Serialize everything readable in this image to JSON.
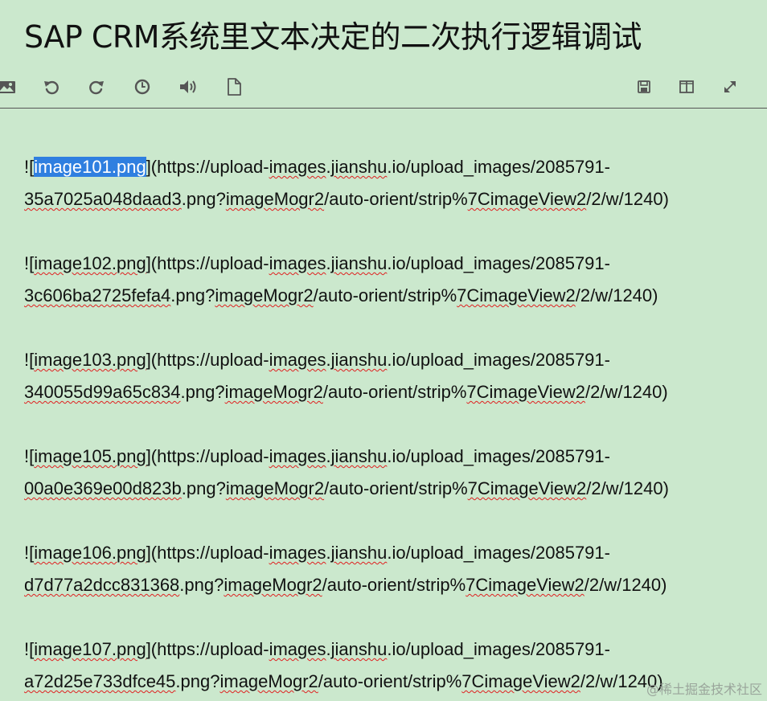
{
  "title": "SAP CRM系统里文本决定的二次执行逻辑调试",
  "toolbar": {
    "left": [
      "image-icon",
      "undo-icon",
      "redo-icon",
      "history-icon",
      "speaker-icon",
      "document-icon"
    ],
    "right": [
      "save-icon",
      "split-view-icon",
      "fullscreen-icon"
    ]
  },
  "entries": [
    {
      "prefix": "![",
      "name": "image101.png",
      "mid": "](https://upload-",
      "w1": "images",
      "t1": ".",
      "w2": "jianshu",
      "t2": ".io/upload_images/2085791-",
      "hash": "35a7025a048daad3",
      "t3": ".png?",
      "w3": "imageMogr2",
      "t4": "/auto-orient/strip%",
      "w4": "7CimageView2",
      "t5": "/2/w/1240)"
    },
    {
      "prefix": "![",
      "name": "image102.png",
      "mid": "](https://upload-",
      "w1": "images",
      "t1": ".",
      "w2": "jianshu",
      "t2": ".io/upload_images/2085791-",
      "hash": "3c606ba2725fefa4",
      "t3": ".png?",
      "w3": "imageMogr2",
      "t4": "/auto-orient/strip%",
      "w4": "7CimageView2",
      "t5": "/2/w/1240)"
    },
    {
      "prefix": "![",
      "name": "image103.png",
      "mid": "](https://upload-",
      "w1": "images",
      "t1": ".",
      "w2": "jianshu",
      "t2": ".io/upload_images/2085791-",
      "hash": "340055d99a65c834",
      "t3": ".png?",
      "w3": "imageMogr2",
      "t4": "/auto-orient/strip%",
      "w4": "7CimageView2",
      "t5": "/2/w/1240)"
    },
    {
      "prefix": "![",
      "name": "image105.png",
      "mid": "](https://upload-",
      "w1": "images",
      "t1": ".",
      "w2": "jianshu",
      "t2": ".io/upload_images/2085791-",
      "hash": "00a0e369e00d823b",
      "t3": ".png?",
      "w3": "imageMogr2",
      "t4": "/auto-orient/strip%",
      "w4": "7CimageView2",
      "t5": "/2/w/1240)"
    },
    {
      "prefix": "![",
      "name": "image106.png",
      "mid": "](https://upload-",
      "w1": "images",
      "t1": ".",
      "w2": "jianshu",
      "t2": ".io/upload_images/2085791-",
      "hash": "d7d77a2dcc831368",
      "t3": ".png?",
      "w3": "imageMogr2",
      "t4": "/auto-orient/strip%",
      "w4": "7CimageView2",
      "t5": "/2/w/1240)"
    },
    {
      "prefix": "![",
      "name": "image107.png",
      "mid": "](https://upload-",
      "w1": "images",
      "t1": ".",
      "w2": "jianshu",
      "t2": ".io/upload_images/2085791-",
      "hash": "a72d25e733dfce45",
      "t3": ".png?",
      "w3": "imageMogr2",
      "t4": "/auto-orient/strip%",
      "w4": "7CimageView2",
      "t5": "/2/w/1240)"
    }
  ],
  "selection": {
    "entry_index": 0,
    "text": "image101.png",
    "color": "#2f7fe0"
  },
  "colors": {
    "background": "#cbe8cd",
    "squiggle": "#e02020",
    "text": "#111111"
  },
  "watermark": "@稀土掘金技术社区"
}
